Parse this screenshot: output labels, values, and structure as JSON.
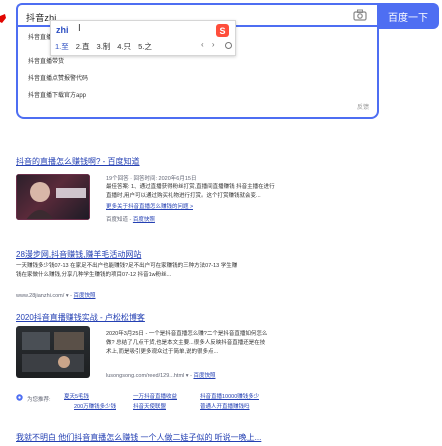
{
  "search": {
    "query": "抖音zhi",
    "button_label": "百度一下"
  },
  "ime": {
    "pinyin": "zhi",
    "cursor": "I",
    "logo": "S",
    "candidates": [
      "1.至",
      "2.直",
      "3.制",
      "4.只",
      "5.之"
    ],
    "nav": "‹ ›"
  },
  "suggestions": {
    "items": [
      "抖音直播伴侣",
      "抖音直播带货",
      "抖音直播点赞报警代码",
      "抖音直播下载官方app"
    ],
    "feedback": "反馈"
  },
  "results": [
    {
      "title": "抖音的直播怎么赚钱啊? - 百度知道",
      "meta": "19个回答 · 回答时间: 2020年6月15日",
      "lines": [
        "最佳答案: 1、通过直播获得粉丝打赏,直播间直播赚钱 抖音主播在进行",
        "直播时,用户可以通过购买礼物进行打赏。这个打赏赚钱就会变...",
        "更多关于抖音直播怎么赚钱的问题 >"
      ],
      "source": "百度知道",
      "snapshot": "百度快照"
    },
    {
      "title": "28漫步网,抖音赚钱,赚羊毛活动网站",
      "lines": [
        "一天赚钱多少钱07-13 在家足不出户也能赚钱?足不出户可在家赚钱的三种方法07-13 学生赚",
        "钱在家做什么赚钱,分享几种学生赚钱的项目07-12 抖音1w粉丝..."
      ],
      "url": "www.28jianzhi.com/ ▾",
      "snapshot": "百度快照"
    },
    {
      "title": "2020抖音直播赚钱实战 - 卢松松博客",
      "lines": [
        "2020年3月25日 - 一个是抖音直播怎么赚?二个是抖音直播如何怎么",
        "做? 总结了几点干货,也是本文主要...很多人反映抖音直播还是在技",
        "术上,而是吸引更多观众过于简单,说的很多点..."
      ],
      "url": "lusongsong.com/reed/129...html ▾",
      "snapshot": "百度快照"
    }
  ],
  "related": {
    "label": "为您推荐:",
    "items": [
      "夏天5毛钱",
      "一万抖音直播收益",
      "抖音直播10000赚钱多少",
      "200万赚钱多少钱",
      "抖音天使联盟",
      "普通人开直播赚钱吗"
    ]
  },
  "last_result_title": "我就不明白 他们抖音直播怎么赚钱 一个人做二娃子似的 听说一晚上..."
}
